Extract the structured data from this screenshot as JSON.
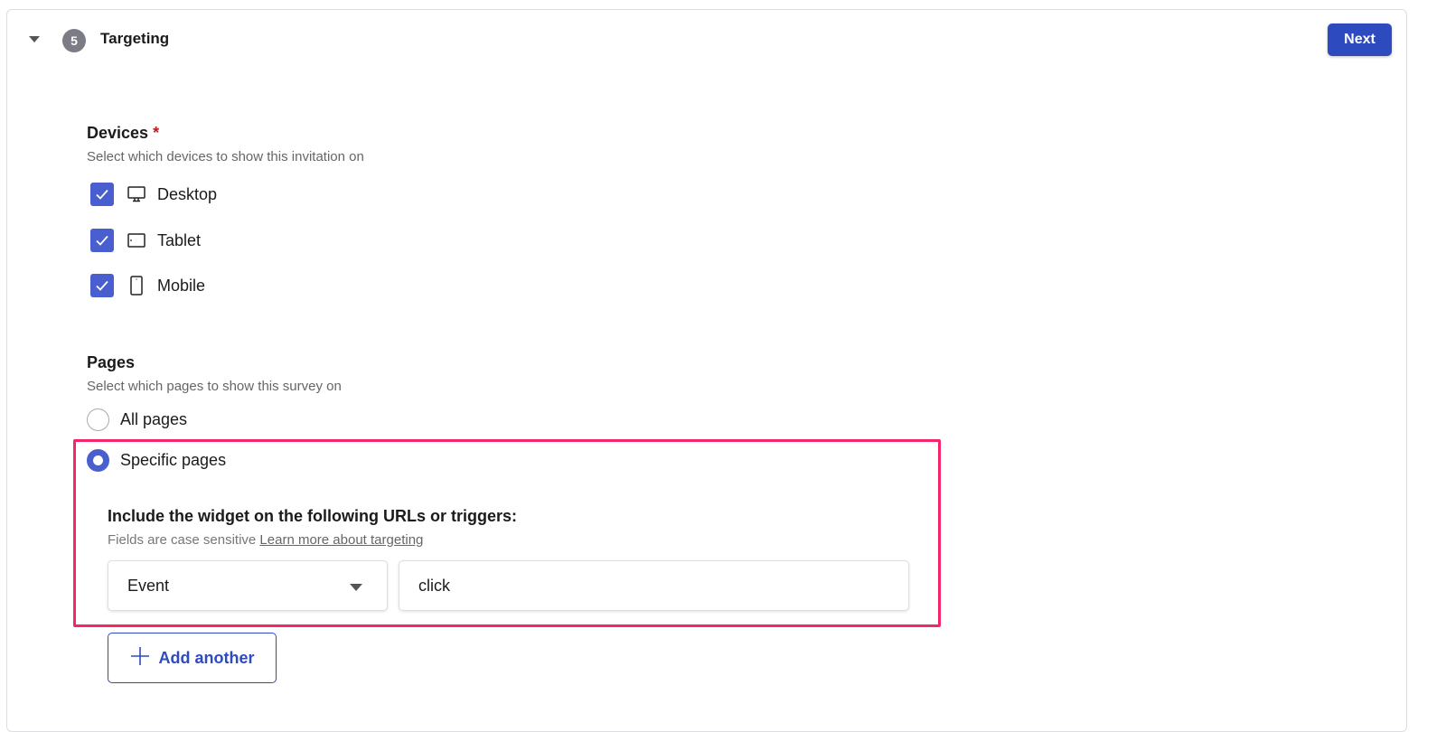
{
  "section": {
    "step_number": "5",
    "title": "Targeting",
    "next_label": "Next"
  },
  "devices": {
    "label": "Devices",
    "required_mark": "*",
    "description": "Select which devices to show this invitation on",
    "options": [
      {
        "label": "Desktop",
        "icon": "desktop-icon",
        "checked": true
      },
      {
        "label": "Tablet",
        "icon": "tablet-icon",
        "checked": true
      },
      {
        "label": "Mobile",
        "icon": "mobile-icon",
        "checked": true
      }
    ]
  },
  "pages": {
    "label": "Pages",
    "description": "Select which pages to show this survey on",
    "options": [
      {
        "label": "All pages",
        "selected": false
      },
      {
        "label": "Specific pages",
        "selected": true
      }
    ],
    "include_heading": "Include the widget on the following URLs or triggers:",
    "note": "Fields are case sensitive",
    "learn_more": "Learn more about targeting",
    "rule": {
      "type": "Event",
      "value": "click"
    },
    "add_another_label": "Add another"
  },
  "colors": {
    "accent": "#2d4bbf",
    "checkbox": "#4a5fcf",
    "highlight": "#f5256b",
    "required": "#c4161c"
  }
}
